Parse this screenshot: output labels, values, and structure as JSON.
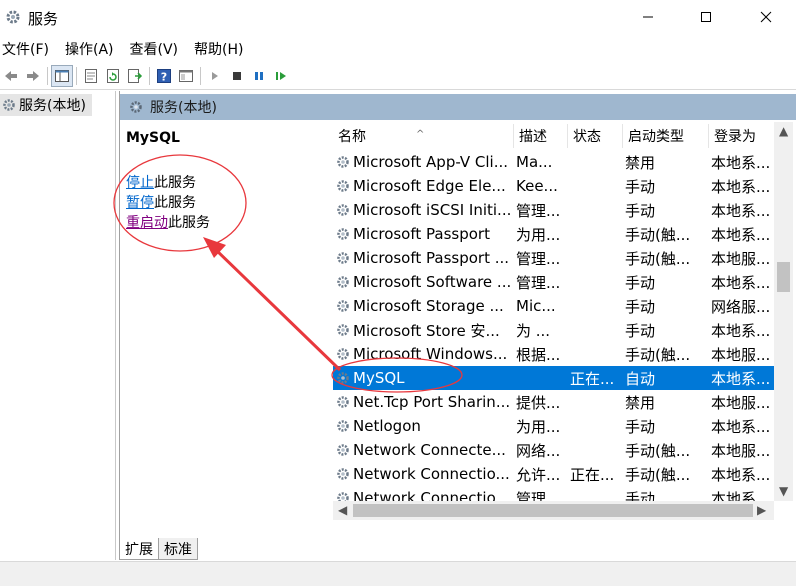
{
  "window": {
    "title": "服务",
    "minimize_glyph": "—",
    "maximize_glyph": "☐",
    "close_glyph": "✕"
  },
  "menu": [
    {
      "label": "文件(F)"
    },
    {
      "label": "操作(A)"
    },
    {
      "label": "查看(V)"
    },
    {
      "label": "帮助(H)"
    }
  ],
  "toolbar": {
    "icons": [
      "back-icon",
      "forward-icon",
      "show-hide-tree-icon",
      "properties-icon",
      "refresh-icon",
      "export-list-icon",
      "help-icon",
      "console-view-icon",
      "start-service-icon",
      "stop-service-icon",
      "pause-service-icon",
      "restart-service-icon"
    ]
  },
  "tree": {
    "root_label": "服务(本地)"
  },
  "pane": {
    "header": "服务(本地)",
    "selected_service": "MySQL",
    "actions": [
      {
        "link": "停止",
        "suffix": "此服务"
      },
      {
        "link": "暂停",
        "suffix": "此服务"
      },
      {
        "link": "重启动",
        "suffix": "此服务"
      }
    ]
  },
  "list": {
    "columns": [
      "名称",
      "描述",
      "状态",
      "启动类型",
      "登录为"
    ],
    "sort_indicator": "^",
    "rows": [
      {
        "name": "Microsoft App-V Cli...",
        "desc": "Ma...",
        "status": "",
        "startup": "禁用",
        "logon": "本地系..."
      },
      {
        "name": "Microsoft Edge Ele...",
        "desc": "Kee...",
        "status": "",
        "startup": "手动",
        "logon": "本地系..."
      },
      {
        "name": "Microsoft iSCSI Initi...",
        "desc": "管理...",
        "status": "",
        "startup": "手动",
        "logon": "本地系..."
      },
      {
        "name": "Microsoft Passport",
        "desc": "为用...",
        "status": "",
        "startup": "手动(触...",
        "logon": "本地系..."
      },
      {
        "name": "Microsoft Passport ...",
        "desc": "管理...",
        "status": "",
        "startup": "手动(触...",
        "logon": "本地服..."
      },
      {
        "name": "Microsoft Software ...",
        "desc": "管理...",
        "status": "",
        "startup": "手动",
        "logon": "本地系..."
      },
      {
        "name": "Microsoft Storage ...",
        "desc": "Mic...",
        "status": "",
        "startup": "手动",
        "logon": "网络服..."
      },
      {
        "name": "Microsoft Store 安...",
        "desc": "为 ...",
        "status": "",
        "startup": "手动",
        "logon": "本地系..."
      },
      {
        "name": "Microsoft Windows...",
        "desc": "根据...",
        "status": "",
        "startup": "手动(触...",
        "logon": "本地服..."
      },
      {
        "name": "MySQL",
        "desc": "",
        "status": "正在...",
        "startup": "自动",
        "logon": "本地系...",
        "selected": true
      },
      {
        "name": "Net.Tcp Port Sharin...",
        "desc": "提供...",
        "status": "",
        "startup": "禁用",
        "logon": "本地服..."
      },
      {
        "name": "Netlogon",
        "desc": "为用...",
        "status": "",
        "startup": "手动",
        "logon": "本地系..."
      },
      {
        "name": "Network Connecte...",
        "desc": "网络...",
        "status": "",
        "startup": "手动(触...",
        "logon": "本地服..."
      },
      {
        "name": "Network Connectio...",
        "desc": "允许...",
        "status": "正在...",
        "startup": "手动(触...",
        "logon": "本地系..."
      },
      {
        "name": "Network Connectio...",
        "desc": "管理...",
        "status": "",
        "startup": "手动",
        "logon": "本地系..."
      }
    ]
  },
  "tabs": [
    {
      "label": "扩展"
    },
    {
      "label": "标准"
    }
  ],
  "colors": {
    "selection": "#0078d7",
    "pane_header": "#9fb7cf",
    "link": "#0066cc",
    "visited_link": "#800080",
    "annotation": "#e8383d"
  }
}
